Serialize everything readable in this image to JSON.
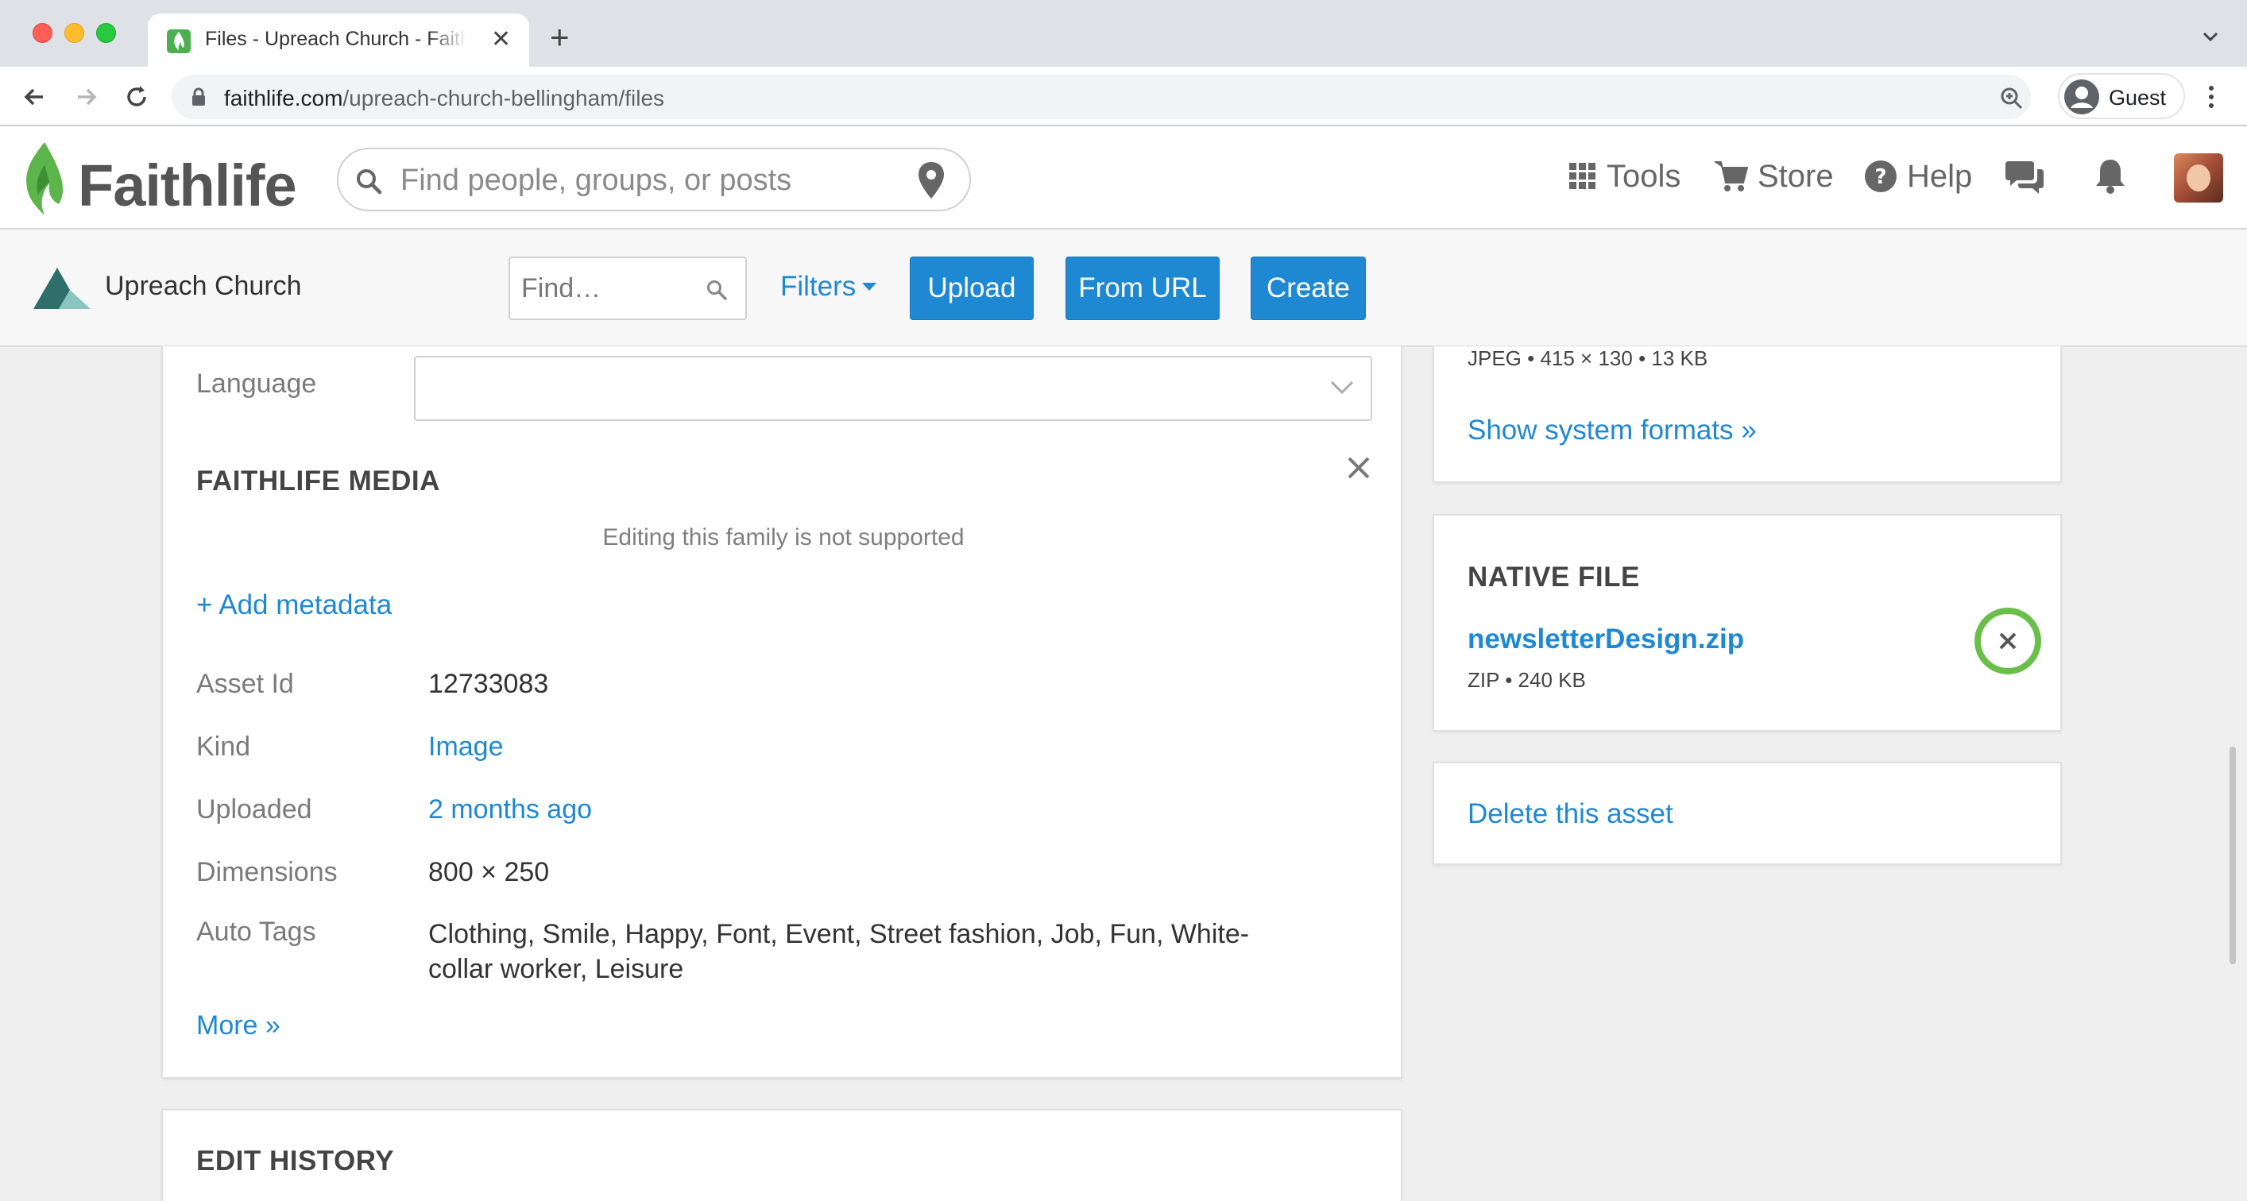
{
  "browser": {
    "tab_title": "Files - Upreach Church - Faithlife",
    "tab_close": "✕",
    "new_tab": "+",
    "url_host": "faithlife.com",
    "url_path": "/upreach-church-bellingham/files",
    "profile_label": "Guest"
  },
  "header": {
    "logo_text": "Faithlife",
    "search_placeholder": "Find people, groups, or posts",
    "nav": {
      "tools": "Tools",
      "store": "Store",
      "help": "Help"
    }
  },
  "subheader": {
    "church_name": "Upreach Church",
    "find_placeholder": "Find…",
    "filters_label": "Filters",
    "upload_label": "Upload",
    "from_url_label": "From URL",
    "create_label": "Create"
  },
  "details": {
    "language_label": "Language",
    "language_value": "",
    "media_section_title": "FAITHLIFE MEDIA",
    "not_supported_notice": "Editing this family is not supported",
    "add_metadata_label": "+ Add metadata",
    "rows": [
      {
        "label": "Asset Id",
        "value": "12733083"
      },
      {
        "label": "Kind",
        "value": "Image"
      },
      {
        "label": "Uploaded",
        "value": "2 months ago"
      },
      {
        "label": "Dimensions",
        "value": "800 × 250"
      },
      {
        "label": "Auto Tags",
        "value": "Clothing, Smile, Happy, Font, Event, Street fashion, Job, Fun, White-collar worker, Leisure"
      }
    ],
    "more_label": "More »",
    "edit_history_title": "EDIT HISTORY"
  },
  "sidebar": {
    "format_meta": "JPEG • 415 × 130 • 13 KB",
    "show_system_formats": "Show system formats »",
    "native_file_title": "NATIVE FILE",
    "native_file_name": "newsletterDesign.zip",
    "native_file_meta": "ZIP • 240 KB",
    "delete_asset_label": "Delete this asset"
  },
  "colors": {
    "link": "#1e88d2",
    "button": "#1e88d2",
    "highlight_ring": "#6abf4b",
    "logo_green": "#5cb54a"
  }
}
